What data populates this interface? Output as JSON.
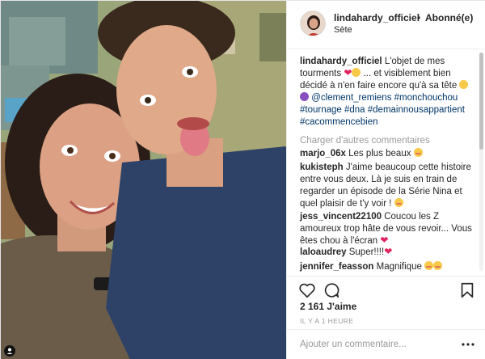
{
  "header": {
    "username": "lindahardy_officiel",
    "separator": "•",
    "follow_status": "Abonné(e)",
    "location": "Sète"
  },
  "caption": {
    "username": "lindahardy_officiel",
    "text_1": "L'objet de mes tourments",
    "text_2": "... et visiblement bien décidé à n'en faire encore qu'à sa tête",
    "mention": "@clement_remiens",
    "hashtags": "#monchouchou #tournage #dna #demainnousappartient #cacommencebien"
  },
  "load_more": "Charger d'autres commentaires",
  "comments": [
    {
      "user": "marjo_06x",
      "text": "Les plus beaux",
      "emoji": "heart-eyes-emoji"
    },
    {
      "user": "kukisteph",
      "text": "J'aime beaucoup cette histoire entre vous deux. Là je suis en train de regarder un épisode de la Série Nina et quel plaisir de t'y voir !",
      "emoji": "blowing-kiss-emoji"
    },
    {
      "user": "jess_vincent22100",
      "text": "Coucou les Z amoureux trop hâte de vous revoir... Vous êtes chou à l'écran",
      "emoji": "heart-emoji"
    },
    {
      "user": "laloaudrey",
      "text": "Super!!!!",
      "emoji": "heart-emoji"
    },
    {
      "user": "jennifer_feasson",
      "text": "Magnifique",
      "emoji": "heart-eyes-emoji"
    }
  ],
  "likes": "2 161 J'aime",
  "timestamp": "IL Y A 1 HEURE",
  "add_comment": {
    "placeholder": "Ajouter un commentaire..."
  },
  "icons": {
    "like": "heart-outline-icon",
    "comment": "speech-bubble-icon",
    "save": "bookmark-icon",
    "more": "three-dots-icon"
  },
  "colors": {
    "link": "#003569",
    "muted": "#999999",
    "heart": "#e0245e"
  }
}
